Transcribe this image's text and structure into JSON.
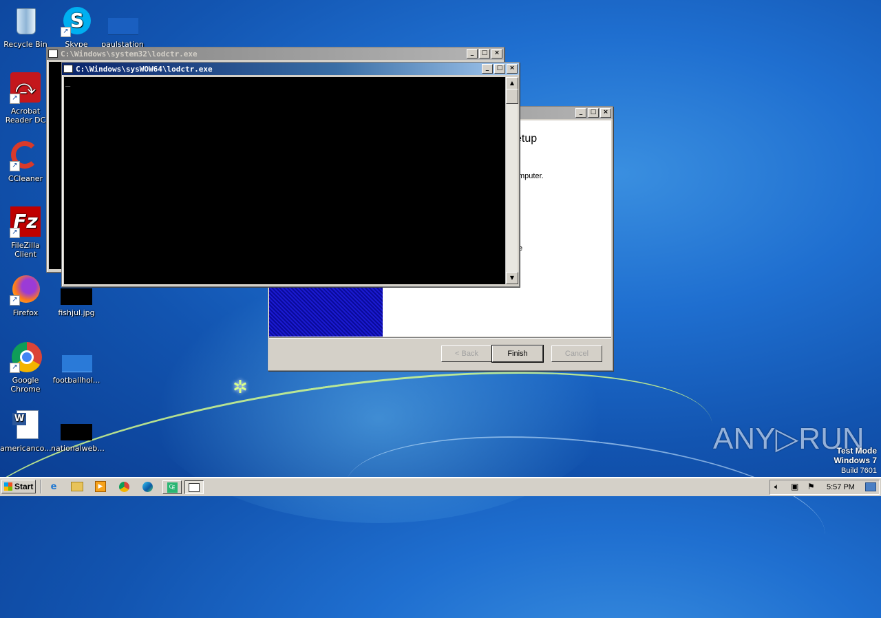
{
  "desktop": {
    "icons": [
      {
        "label": "Recycle Bin"
      },
      {
        "label": "Skype"
      },
      {
        "label": "paulstation"
      },
      {
        "label": "Acrobat Reader DC"
      },
      {
        "label": "CCleaner"
      },
      {
        "label": "FileZilla Client"
      },
      {
        "label": "Firefox"
      },
      {
        "label": "fishjul.jpg"
      },
      {
        "label": "Google Chrome"
      },
      {
        "label": "footballhol..."
      },
      {
        "label": "americanco..."
      },
      {
        "label": "nationalweb..."
      }
    ]
  },
  "windows": {
    "back_console": {
      "title": "C:\\Windows\\system32\\lodctr.exe"
    },
    "front_console": {
      "title": "C:\\Windows\\sysWOW64\\lodctr.exe",
      "cursor": "_"
    },
    "setup": {
      "heading_fragment": "etup",
      "text_fragment": "mputer.",
      "small_fragment": "e",
      "back_label": "< Back",
      "finish_label": "Finish",
      "cancel_label": "Cancel"
    },
    "buttons": {
      "minimize": "_",
      "maximize": "□",
      "close": "×",
      "scroll_up": "▲",
      "scroll_down": "▼"
    }
  },
  "taskbar": {
    "start_label": "Start",
    "clock": "5:57 PM"
  },
  "watermark": {
    "brand": "ANY▷RUN",
    "line1": "Test Mode",
    "line2": "Windows 7",
    "line3": "Build 7601"
  },
  "colors": {
    "console_bg": "#000000",
    "title_active": "#0a246a",
    "desktop": "#1f6fd0"
  }
}
